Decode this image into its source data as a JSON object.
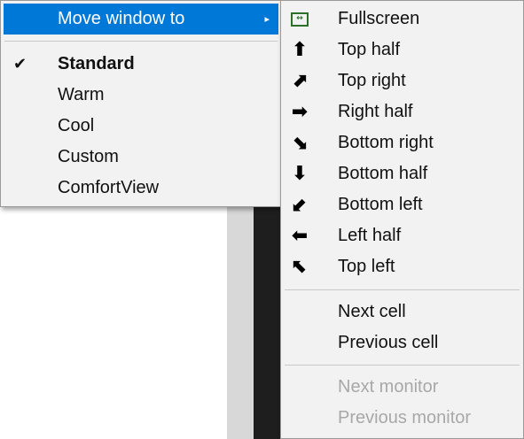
{
  "main_menu": {
    "move_window_label": "Move window to",
    "submenu_arrow": "▸",
    "items": [
      {
        "label": "Standard",
        "checked": true,
        "check_glyph": "✔"
      },
      {
        "label": "Warm"
      },
      {
        "label": "Cool"
      },
      {
        "label": "Custom"
      },
      {
        "label": "ComfortView"
      }
    ]
  },
  "submenu": {
    "items": [
      {
        "label": "Fullscreen",
        "icon": "fullscreen-icon",
        "glyph": "⇔"
      },
      {
        "label": "Top half",
        "icon": "arrow-up-icon",
        "glyph": "🡅"
      },
      {
        "label": "Top right",
        "icon": "arrow-up-right-icon",
        "glyph": "🡕"
      },
      {
        "label": "Right half",
        "icon": "arrow-right-icon",
        "glyph": "🡆"
      },
      {
        "label": "Bottom right",
        "icon": "arrow-down-right-icon",
        "glyph": "🡖"
      },
      {
        "label": "Bottom half",
        "icon": "arrow-down-icon",
        "glyph": "🡇"
      },
      {
        "label": "Bottom left",
        "icon": "arrow-down-left-icon",
        "glyph": "🡗"
      },
      {
        "label": "Left half",
        "icon": "arrow-left-icon",
        "glyph": "🡄"
      },
      {
        "label": "Top left",
        "icon": "arrow-up-left-icon",
        "glyph": "🡔"
      }
    ],
    "cells": [
      {
        "label": "Next cell"
      },
      {
        "label": "Previous cell"
      }
    ],
    "monitors": [
      {
        "label": "Next monitor",
        "disabled": true
      },
      {
        "label": "Previous monitor",
        "disabled": true
      }
    ]
  },
  "colors": {
    "highlight": "#0078d7",
    "menu_bg": "#f2f2f2",
    "disabled_text": "#a8a8a8",
    "fullscreen_icon": "#2b6f2b"
  }
}
